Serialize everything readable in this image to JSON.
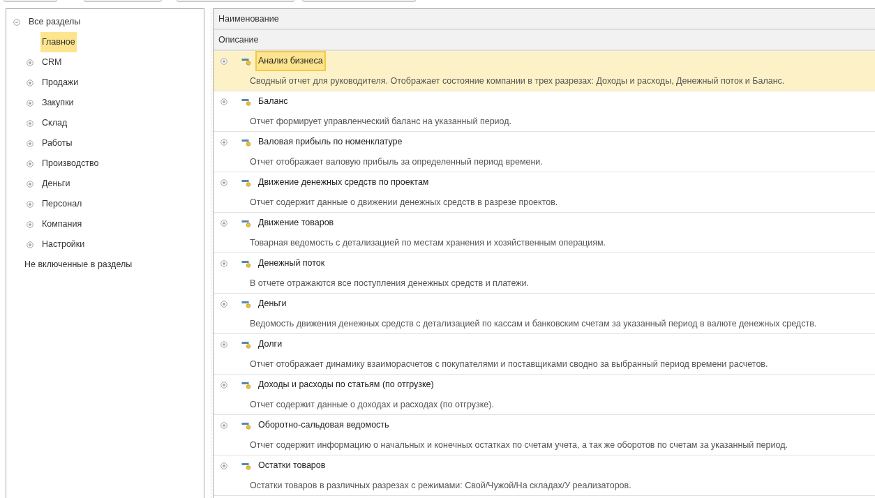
{
  "toolbar": [
    {
      "kind": "button"
    },
    {
      "kind": "button"
    },
    {
      "kind": "button"
    },
    {
      "kind": "button"
    }
  ],
  "sidebar": {
    "items": [
      {
        "label": "Все разделы",
        "expanded": true,
        "selected": false,
        "children": [
          {
            "label": "Главное",
            "selected": true
          },
          {
            "label": "CRM",
            "expanded": false,
            "selected": false
          },
          {
            "label": "Продажи",
            "expanded": false,
            "selected": false
          },
          {
            "label": "Закупки",
            "expanded": false,
            "selected": false
          },
          {
            "label": "Склад",
            "expanded": false,
            "selected": false
          },
          {
            "label": "Работы",
            "expanded": false,
            "selected": false
          },
          {
            "label": "Производство",
            "expanded": false,
            "selected": false
          },
          {
            "label": "Деньги",
            "expanded": false,
            "selected": false
          },
          {
            "label": "Персонал",
            "expanded": false,
            "selected": false
          },
          {
            "label": "Компания",
            "expanded": false,
            "selected": false
          },
          {
            "label": "Настройки",
            "expanded": false,
            "selected": false
          }
        ]
      },
      {
        "label": "Не включенные в разделы",
        "selected": false
      }
    ]
  },
  "table": {
    "columns": [
      "Наименование",
      "Описание"
    ],
    "rows": [
      {
        "name": "Анализ бизнеса",
        "description": "Сводный отчет для руководителя. Отображает состояние компании в трех разрезах: Доходы и расходы, Денежный поток и Баланс.",
        "selected": true,
        "expanded": false
      },
      {
        "name": "Баланс",
        "description": "Отчет формирует управленческий баланс на указанный период.",
        "selected": false,
        "expanded": false
      },
      {
        "name": "Валовая прибыль по номенклатуре",
        "description": "Отчет отображает валовую прибыль за определенный период времени.",
        "selected": false,
        "expanded": false
      },
      {
        "name": "Движение денежных средств по проектам",
        "description": "Отчет содержит данные о движении денежных средств в разрезе проектов.",
        "selected": false,
        "expanded": false
      },
      {
        "name": "Движение товаров",
        "description": "Товарная ведомость с детализацией по местам хранения и хозяйственным операциям.",
        "selected": false,
        "expanded": false
      },
      {
        "name": "Денежный поток",
        "description": "В отчете отражаются все поступления денежных средств и платежи.",
        "selected": false,
        "expanded": false
      },
      {
        "name": "Деньги",
        "description": "Ведомость движения денежных средств с детализацией по кассам и банковским счетам за указанный период в валюте денежных средств.",
        "selected": false,
        "expanded": false
      },
      {
        "name": "Долги",
        "description": "Отчет отображает динамику взаиморасчетов с покупателями и поставщиками сводно за выбранный период времени расчетов.",
        "selected": false,
        "expanded": false
      },
      {
        "name": "Доходы и расходы по статьям (по отгрузке)",
        "description": "Отчет содержит данные о доходах и расходах (по отгрузке).",
        "selected": false,
        "expanded": false
      },
      {
        "name": "Оборотно-сальдовая ведомость",
        "description": "Отчет содержит информацию о начальных и конечных остатках по счетам учета, а так же оборотов по счетам за указанный период.",
        "selected": false,
        "expanded": false
      },
      {
        "name": "Остатки товаров",
        "description": "Остатки товаров в различных разрезах с режимами: Свой/Чужой/На складах/У реализаторов.",
        "selected": false,
        "expanded": false
      }
    ]
  }
}
